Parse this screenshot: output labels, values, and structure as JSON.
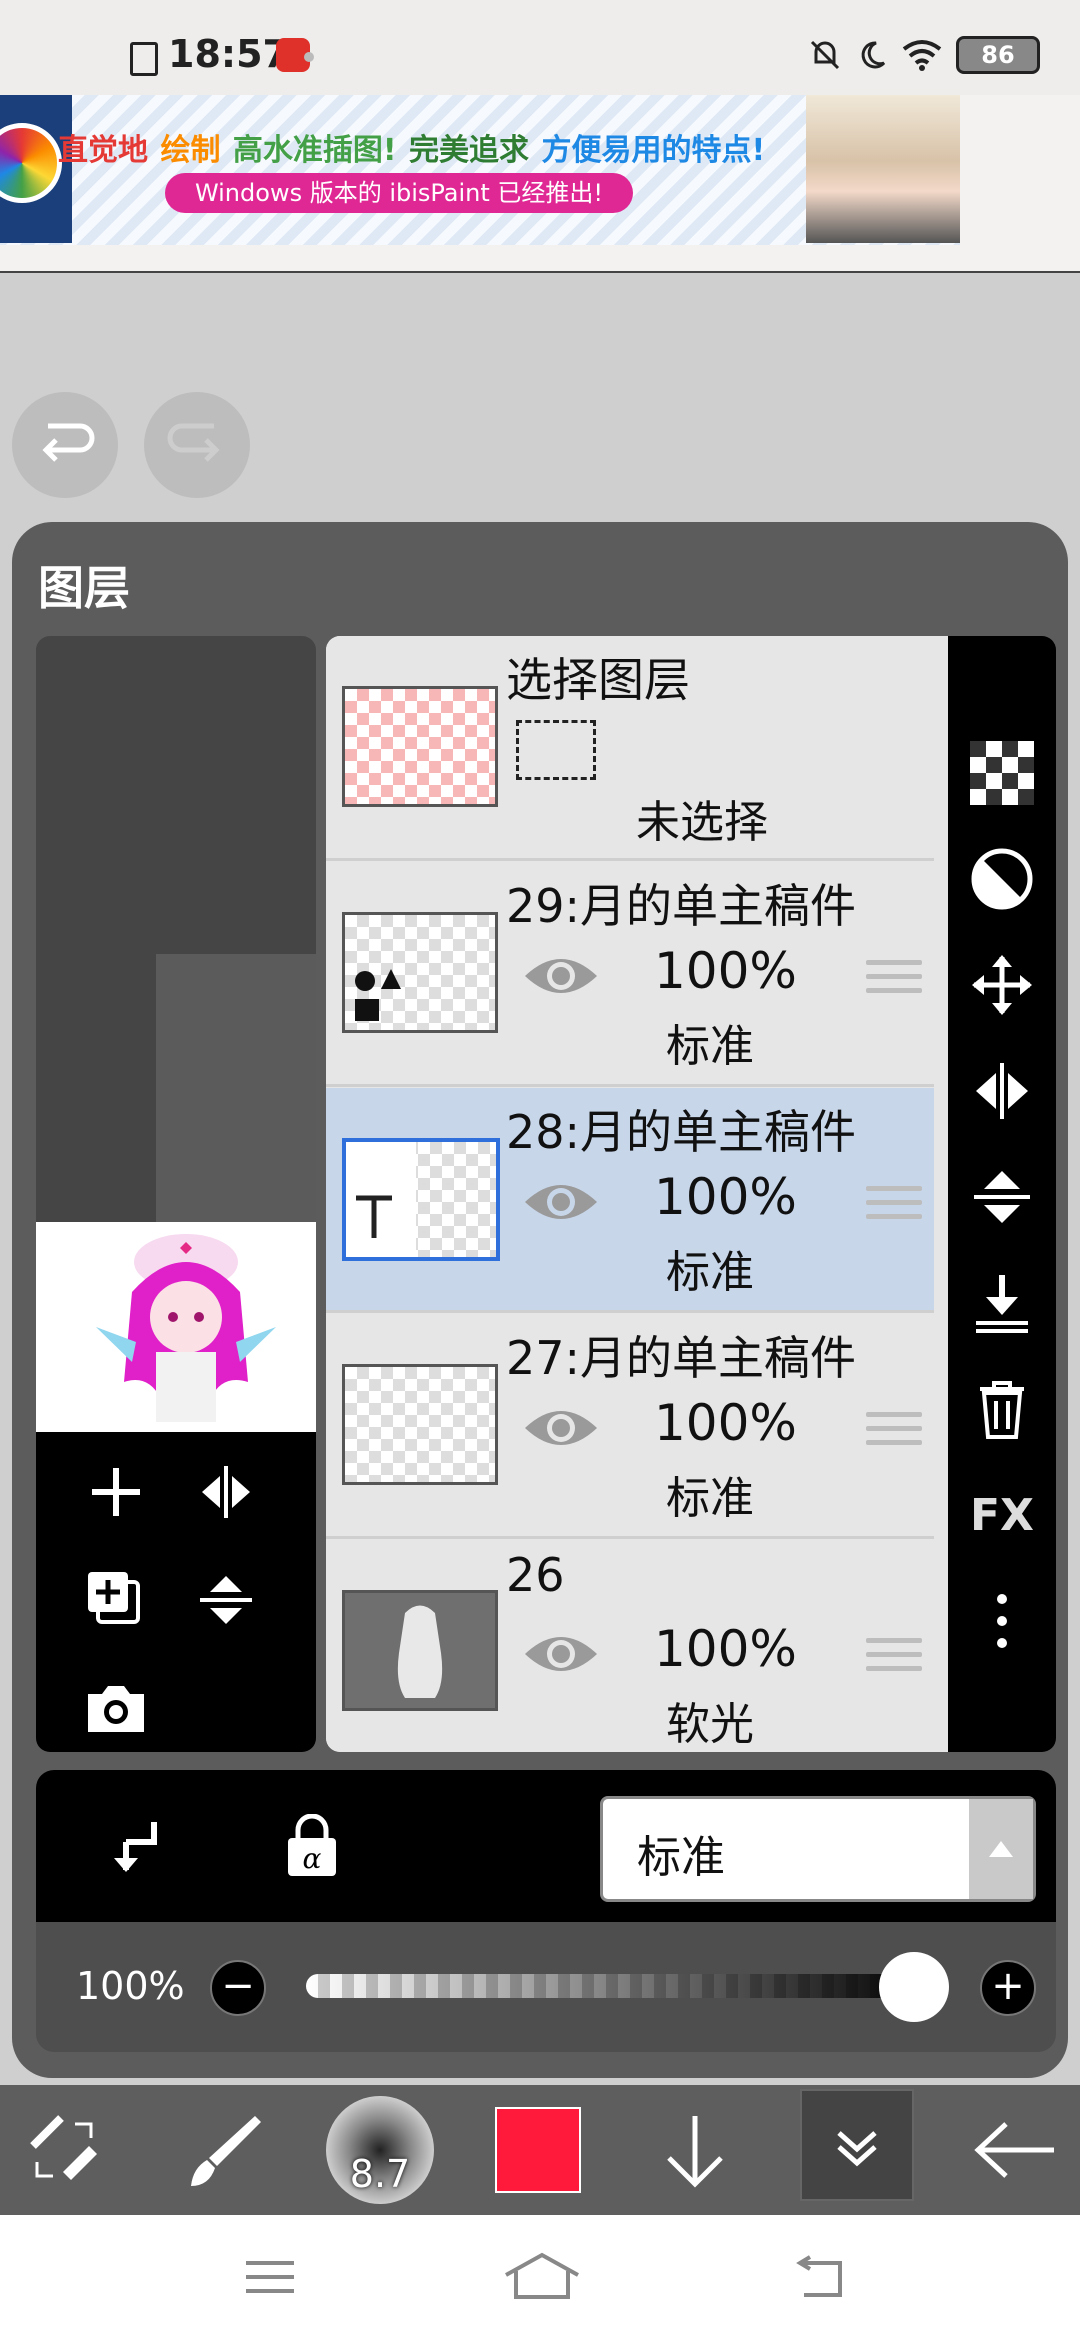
{
  "status_bar": {
    "time": "18:57",
    "battery": "86"
  },
  "ad_banner": {
    "headline_parts": [
      {
        "text": "直觉地",
        "color": "#e53935"
      },
      {
        "text": "绘制",
        "color": "#fb8c00"
      },
      {
        "text": "高水准插图!",
        "color": "#43a047"
      },
      {
        "text": "完美追求",
        "color": "#2e7d32"
      },
      {
        "text": "方便易用的特点!",
        "color": "#1e88e5"
      }
    ],
    "pill_text": "Windows 版本的 ibisPaint 已经推出!"
  },
  "layers_panel": {
    "title": "图层",
    "select_layer": {
      "title": "选择图层",
      "status": "未选择"
    },
    "layers": [
      {
        "name": "29:月的单主稿件",
        "opacity": "100%",
        "blend": "标准",
        "selected": false,
        "thumb": "shapes"
      },
      {
        "name": "28:月的单主稿件",
        "opacity": "100%",
        "blend": "标准",
        "selected": true,
        "thumb": "text"
      },
      {
        "name": "27:月的单主稿件",
        "opacity": "100%",
        "blend": "标准",
        "selected": false,
        "thumb": "empty"
      },
      {
        "name": "26",
        "opacity": "100%",
        "blend": "软光",
        "selected": false,
        "thumb": "noise"
      }
    ],
    "blend_mode_select": "标准",
    "opacity_label": "100%",
    "opacity_value": 1.0,
    "side_tools": [
      "checker-icon",
      "invert-icon",
      "move-icon",
      "flip-horizontal-icon",
      "flip-vertical-icon",
      "merge-down-icon",
      "trash-icon",
      "FX",
      "more-icon"
    ]
  },
  "toolbar": {
    "brush_size": "8.7",
    "color": "#ff1a3c"
  }
}
